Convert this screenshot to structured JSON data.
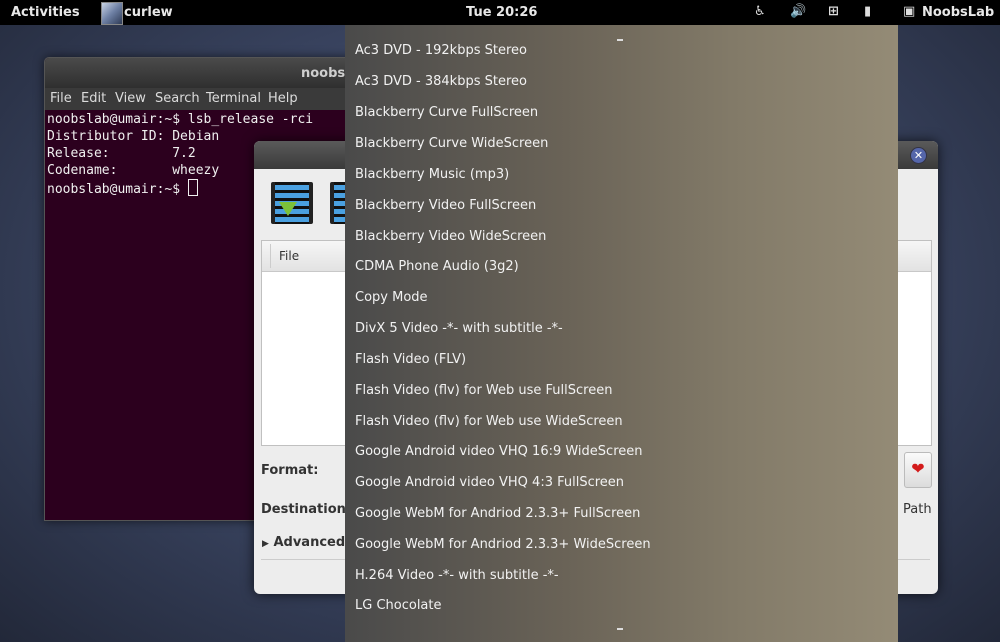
{
  "topbar": {
    "activities": "Activities",
    "app_name": "curlew",
    "clock": "Tue 20:26",
    "user": "NoobsLab",
    "icons": [
      "accessibility-icon",
      "volume-icon",
      "network-icon",
      "battery-icon",
      "user-icon"
    ]
  },
  "terminal": {
    "title": "noobsl",
    "menu": [
      "File",
      "Edit",
      "View",
      "Search",
      "Terminal",
      "Help"
    ],
    "lines": [
      "noobslab@umair:~$ lsb_release -rci",
      "Distributor ID: Debian",
      "Release:        7.2",
      "Codename:       wheezy",
      "noobslab@umair:~$ "
    ]
  },
  "dialog": {
    "column_file": "File",
    "format_label": "Format:",
    "destination_label": "Destination:",
    "advanced_label": "Advanced",
    "path_label": "Path"
  },
  "dropdown": {
    "items": [
      "Ac3 DVD - 192kbps Stereo",
      "Ac3 DVD - 384kbps Stereo",
      "Blackberry Curve FullScreen",
      "Blackberry Curve WideScreen",
      "Blackberry Music (mp3)",
      "Blackberry Video FullScreen",
      "Blackberry Video WideScreen",
      "CDMA Phone Audio (3g2)",
      "Copy Mode",
      "DivX 5 Video -*- with subtitle -*-",
      "Flash Video (FLV)",
      "Flash Video (flv) for Web use FullScreen",
      "Flash Video (flv) for Web use WideScreen",
      "Google Android video VHQ 16:9 WideScreen",
      "Google Android video VHQ 4:3 FullScreen",
      "Google WebM for Andriod 2.3.3+ FullScreen",
      "Google WebM for Andriod 2.3.3+ WideScreen",
      "H.264 Video -*- with subtitle -*-",
      "LG Chocolate"
    ]
  }
}
